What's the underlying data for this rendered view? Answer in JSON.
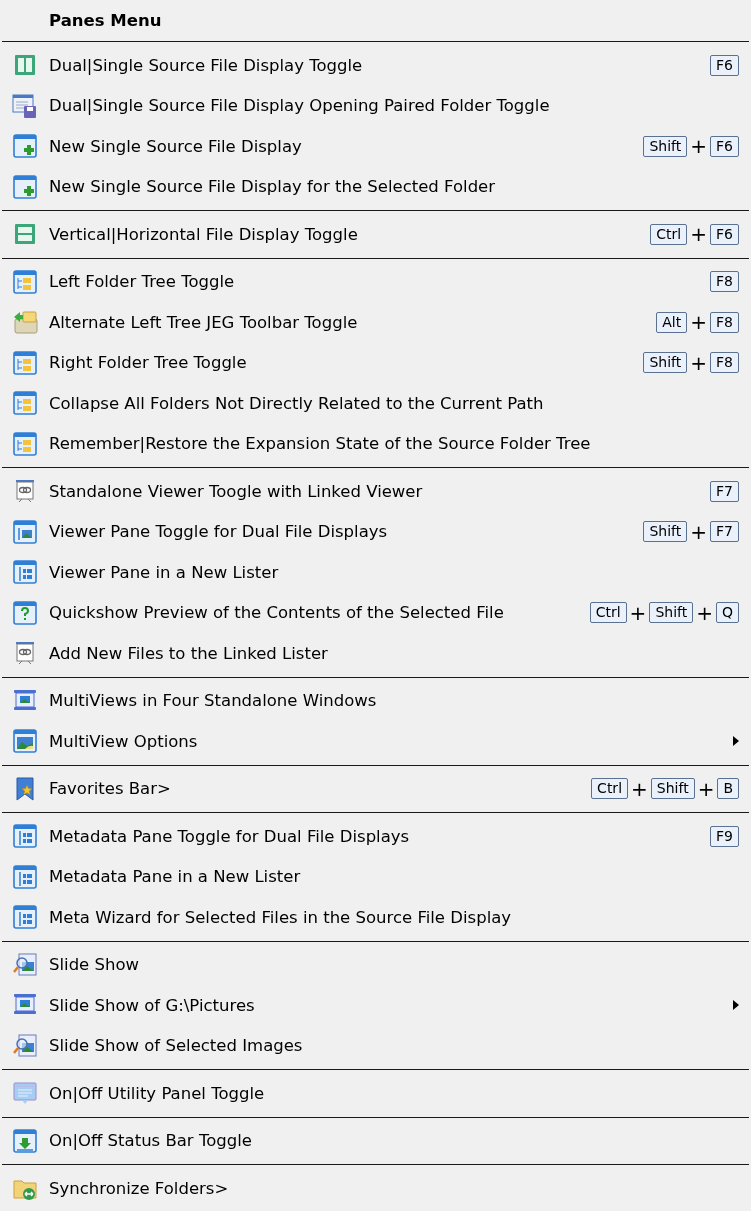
{
  "menu": {
    "title": "Panes Menu",
    "sections": [
      {
        "items": [
          {
            "kind": "dual-pane",
            "label": "Dual|Single Source File Display Toggle",
            "shortcut": [
              {
                "kind": "key",
                "text": "F6"
              }
            ]
          },
          {
            "kind": "list-disk",
            "label": "Dual|Single Source File Display Opening Paired Folder Toggle"
          },
          {
            "kind": "new-pane",
            "label": "New Single Source File Display",
            "shortcut": [
              {
                "kind": "key",
                "text": "Shift"
              },
              {
                "kind": "plus",
                "text": "+"
              },
              {
                "kind": "key",
                "text": "F6"
              }
            ]
          },
          {
            "kind": "new-pane",
            "label": "New Single Source File Display for the Selected Folder"
          }
        ]
      },
      {
        "items": [
          {
            "kind": "split-pane",
            "label": "Vertical|Horizontal File Display Toggle",
            "shortcut": [
              {
                "kind": "key",
                "text": "Ctrl"
              },
              {
                "kind": "plus",
                "text": "+"
              },
              {
                "kind": "key",
                "text": "F6"
              }
            ]
          }
        ]
      },
      {
        "items": [
          {
            "kind": "tree",
            "label": "Left Folder Tree Toggle",
            "shortcut": [
              {
                "kind": "key",
                "text": "F8"
              }
            ]
          },
          {
            "kind": "folder-arrow",
            "label": "Alternate Left Tree JEG Toolbar Toggle",
            "shortcut": [
              {
                "kind": "key",
                "text": "Alt"
              },
              {
                "kind": "plus",
                "text": "+"
              },
              {
                "kind": "key",
                "text": "F8"
              }
            ]
          },
          {
            "kind": "tree",
            "label": "Right Folder Tree Toggle",
            "shortcut": [
              {
                "kind": "key",
                "text": "Shift"
              },
              {
                "kind": "plus",
                "text": "+"
              },
              {
                "kind": "key",
                "text": "F8"
              }
            ]
          },
          {
            "kind": "tree",
            "label": "Collapse All Folders Not Directly Related to the Current Path"
          },
          {
            "kind": "tree",
            "label": "Remember|Restore the Expansion State of the Source Folder Tree"
          }
        ]
      },
      {
        "items": [
          {
            "kind": "link-screen",
            "label": "Standalone Viewer Toogle with Linked Viewer",
            "shortcut": [
              {
                "kind": "key",
                "text": "F7"
              }
            ]
          },
          {
            "kind": "image-pane",
            "label": "Viewer Pane Toggle for Dual File Displays",
            "shortcut": [
              {
                "kind": "key",
                "text": "Shift"
              },
              {
                "kind": "plus",
                "text": "+"
              },
              {
                "kind": "key",
                "text": "F7"
              }
            ]
          },
          {
            "kind": "side-pane",
            "label": "Viewer Pane in a New Lister"
          },
          {
            "kind": "question",
            "label": "Quickshow Preview of the Contents of the Selected File",
            "shortcut": [
              {
                "kind": "key",
                "text": "Ctrl"
              },
              {
                "kind": "plus",
                "text": "+"
              },
              {
                "kind": "key",
                "text": "Shift"
              },
              {
                "kind": "plus",
                "text": "+"
              },
              {
                "kind": "key",
                "text": "Q"
              }
            ]
          },
          {
            "kind": "link-screen",
            "label": "Add New Files to the Linked Lister"
          }
        ]
      },
      {
        "items": [
          {
            "kind": "projector",
            "label": "MultiViews in Four Standalone Windows"
          },
          {
            "kind": "image-window",
            "label": "MultiView Options",
            "submenu": true
          }
        ]
      },
      {
        "items": [
          {
            "kind": "bookmark",
            "label": "Favorites Bar>",
            "shortcut": [
              {
                "kind": "key",
                "text": "Ctrl"
              },
              {
                "kind": "plus",
                "text": "+"
              },
              {
                "kind": "key",
                "text": "Shift"
              },
              {
                "kind": "plus",
                "text": "+"
              },
              {
                "kind": "key",
                "text": "B"
              }
            ]
          }
        ]
      },
      {
        "items": [
          {
            "kind": "side-pane",
            "label": "Metadata Pane Toggle for Dual File Displays",
            "shortcut": [
              {
                "kind": "key",
                "text": "F9"
              }
            ]
          },
          {
            "kind": "side-pane",
            "label": "Metadata Pane in a New Lister"
          },
          {
            "kind": "side-pane",
            "label": "Meta Wizard for Selected Files in the Source File Display"
          }
        ]
      },
      {
        "items": [
          {
            "kind": "magnifier",
            "label": "Slide Show"
          },
          {
            "kind": "projector",
            "label": "Slide Show of G:\\Pictures",
            "submenu": true
          },
          {
            "kind": "magnifier",
            "label": "Slide Show of Selected Images"
          }
        ]
      },
      {
        "items": [
          {
            "kind": "panel",
            "label": "On|Off Utility Panel Toggle"
          }
        ]
      },
      {
        "items": [
          {
            "kind": "status",
            "label": "On|Off Status Bar Toggle"
          }
        ]
      },
      {
        "items": [
          {
            "kind": "sync-folder",
            "label": "Synchronize Folders>"
          }
        ]
      }
    ]
  }
}
